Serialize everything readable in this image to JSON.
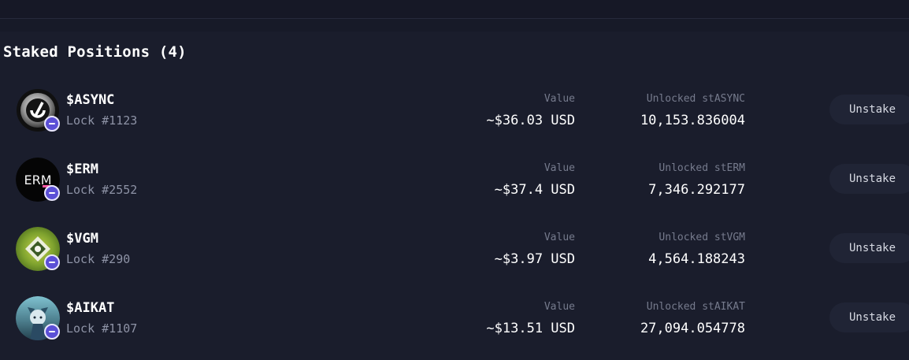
{
  "section": {
    "title": "Staked Positions (4)"
  },
  "positions": [
    {
      "ticker": "$ASYNC",
      "lock": "Lock #1123",
      "value_label": "Value",
      "value": "~$36.03 USD",
      "unlocked_label": "Unlocked stASYNC",
      "unlocked": "10,153.836004",
      "action": "Unstake",
      "logo": "async-logo"
    },
    {
      "ticker": "$ERM",
      "lock": "Lock #2552",
      "value_label": "Value",
      "value": "~$37.4 USD",
      "unlocked_label": "Unlocked stERM",
      "unlocked": "7,346.292177",
      "action": "Unstake",
      "logo": "erm-logo",
      "logo_text": "ERM"
    },
    {
      "ticker": "$VGM",
      "lock": "Lock #290",
      "value_label": "Value",
      "value": "~$3.97 USD",
      "unlocked_label": "Unlocked stVGM",
      "unlocked": "4,564.188243",
      "action": "Unstake",
      "logo": "vgm-logo"
    },
    {
      "ticker": "$AIKAT",
      "lock": "Lock #1107",
      "value_label": "Value",
      "value": "~$13.51 USD",
      "unlocked_label": "Unlocked stAIKAT",
      "unlocked": "27,094.054778",
      "action": "Unstake",
      "logo": "aikat-logo"
    }
  ],
  "colors": {
    "background": "#1a1d2c",
    "button": "#202435",
    "badge": "#5b4fd6",
    "muted_text": "#767b8d"
  },
  "icons": {
    "badge": "staking-badge-icon"
  }
}
